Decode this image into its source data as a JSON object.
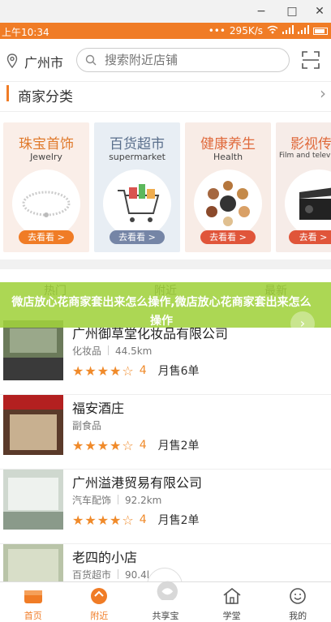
{
  "window": {
    "minimize": "−",
    "maximize": "□",
    "close": "✕"
  },
  "status_bar": {
    "time": "上午10:34",
    "speed": "295K/s",
    "dots": "•••"
  },
  "header": {
    "city": "广州市",
    "search_placeholder": "搜索附近店铺",
    "icons": [
      "location-pin-icon",
      "search-icon",
      "scan-icon"
    ]
  },
  "category_section": {
    "title": "商家分类"
  },
  "categories": [
    {
      "name": "珠宝首饰",
      "sub": "Jewelry",
      "button": "去看看 >"
    },
    {
      "name": "百货超市",
      "sub": "supermarket",
      "button": "去看看 >"
    },
    {
      "name": "健康养生",
      "sub": "Health",
      "button": "去看看 >"
    },
    {
      "name": "影视传",
      "sub": "Film and televi",
      "button": "去看 >"
    }
  ],
  "tabs": [
    "热门",
    "附近",
    "最新"
  ],
  "overlay": {
    "text": "微店放心花商家套出来怎么操作,微店放心花商家套出来怎么操作"
  },
  "stores": [
    {
      "name": "广州御草堂化妆品有限公司",
      "category": "化妆品",
      "distance": "44.5km",
      "stars": "★★★★☆",
      "score": "4",
      "sales": "月售6单"
    },
    {
      "name": "福安酒庄",
      "category": "副食品",
      "distance": "",
      "stars": "★★★★☆",
      "score": "4",
      "sales": "月售2单"
    },
    {
      "name": "广州溢港贸易有限公司",
      "category": "汽车配饰",
      "distance": "92.2km",
      "stars": "★★★★☆",
      "score": "4",
      "sales": "月售2单"
    },
    {
      "name": "老四的小店",
      "category": "百货超市",
      "distance": "90.4l",
      "stars": "",
      "score": "",
      "sales": ""
    }
  ],
  "bottom_nav": [
    {
      "label": "首页"
    },
    {
      "label": "附近"
    },
    {
      "label": "共享宝"
    },
    {
      "label": "学堂"
    },
    {
      "label": "我的"
    }
  ],
  "colors": {
    "accent": "#f07c26",
    "star": "#f08a2a",
    "overlay": "#a0d23c"
  }
}
